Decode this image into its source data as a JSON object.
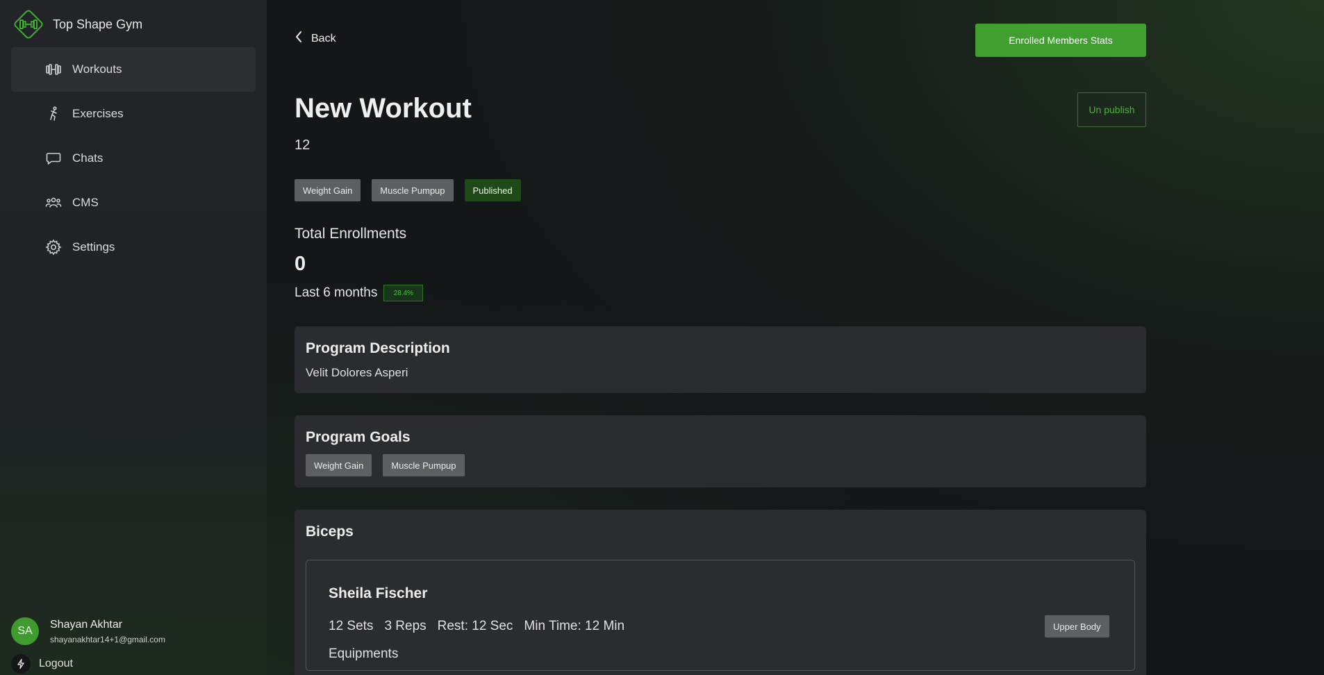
{
  "brand": {
    "name": "Top Shape Gym",
    "logo_icon": "dumbbell-diamond-icon"
  },
  "sidebar": {
    "items": [
      {
        "label": "Workouts",
        "icon": "dumbbell-icon",
        "active": true
      },
      {
        "label": "Exercises",
        "icon": "running-icon",
        "active": false
      },
      {
        "label": "Chats",
        "icon": "chat-bubble-icon",
        "active": false
      },
      {
        "label": "CMS",
        "icon": "users-icon",
        "active": false
      },
      {
        "label": "Settings",
        "icon": "gear-icon",
        "active": false
      }
    ]
  },
  "user": {
    "initials": "SA",
    "name": "Shayan Akhtar",
    "email": "shayanakhtar14+1@gmail.com"
  },
  "logout": {
    "label": "Logout"
  },
  "header": {
    "back_label": "Back",
    "stats_button": "Enrolled Members Stats",
    "unpublish_button": "Un publish"
  },
  "workout": {
    "title": "New Workout",
    "subtitle": "12",
    "tags": [
      "Weight Gain",
      "Muscle Pumpup"
    ],
    "status": "Published"
  },
  "enrollments": {
    "label": "Total Enrollments",
    "count": "0",
    "period": "Last 6 months",
    "change": "28.4%"
  },
  "description": {
    "title": "Program Description",
    "text": "Velit Dolores Asperi"
  },
  "goals": {
    "title": "Program Goals",
    "tags": [
      "Weight Gain",
      "Muscle Pumpup"
    ]
  },
  "section": {
    "title": "Biceps",
    "exercise": {
      "name": "Sheila Fischer",
      "sets": "12 Sets",
      "reps": "3 Reps",
      "rest": "Rest: 12 Sec",
      "min_time": "Min Time: 12 Min",
      "equipments_label": "Equipments",
      "tag": "Upper Body"
    }
  },
  "colors": {
    "accent": "#3f9f2f",
    "published_bg": "#1e4a17",
    "tag_bg": "#5e5f62",
    "card_bg": "#2b2c30"
  }
}
